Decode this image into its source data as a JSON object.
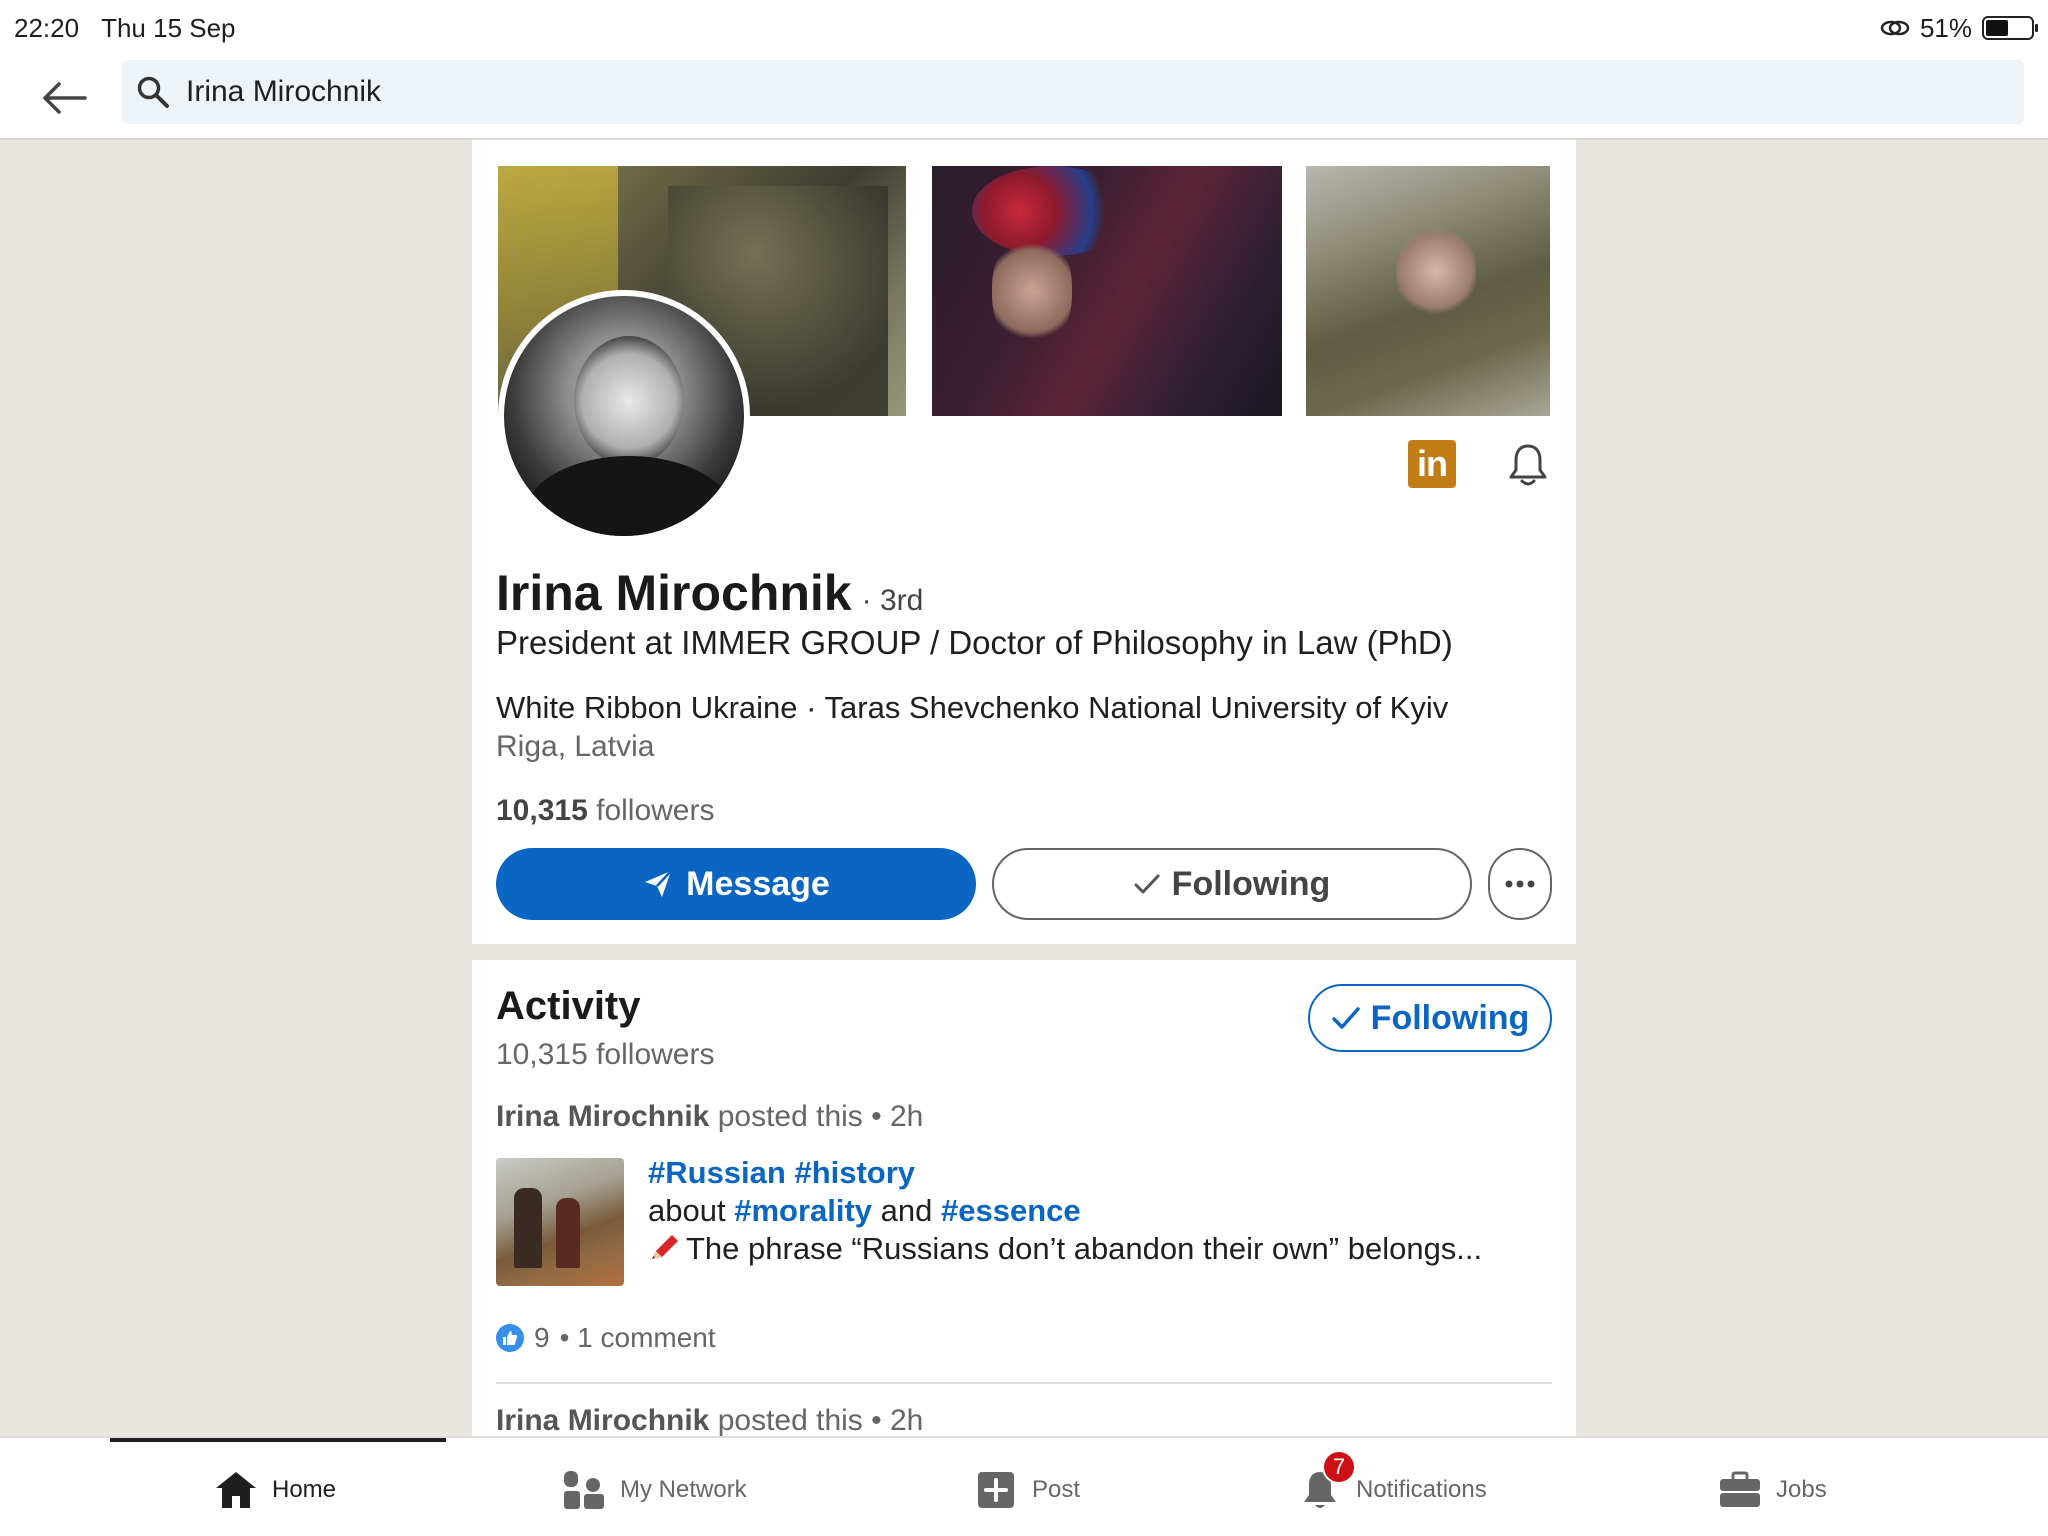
{
  "status_bar": {
    "time": "22:20",
    "date": "Thu 15 Sep",
    "battery": "51%",
    "battery_level": 0.51
  },
  "search": {
    "value": "Irina Mirochnik",
    "placeholder": "Search"
  },
  "profile": {
    "name": "Irina Mirochnik",
    "degree": "· 3rd",
    "headline": "President at IMMER GROUP / Doctor of Philosophy in Law (PhD)",
    "org_line": "White Ribbon Ukraine · Taras Shevchenko National University of Kyiv",
    "location": "Riga, Latvia",
    "followers_count": "10,315",
    "followers_label": "followers",
    "linkedin_badge": "in",
    "message_label": "Message",
    "following_label": "Following"
  },
  "activity": {
    "title": "Activity",
    "followers": "10,315 followers",
    "following_label": "Following",
    "posts": [
      {
        "author": "Irina Mirochnik",
        "meta": "posted this • 2h",
        "tags_line1": "#Russian #history",
        "line2_prefix": "about",
        "tag_morality": "#morality",
        "line2_and": "and",
        "tag_essence": "#essence",
        "line3": "The phrase “Russians don’t abandon their own” belongs...",
        "reaction_count": "9",
        "comments": "• 1 comment"
      },
      {
        "author": "Irina Mirochnik",
        "meta": "posted this • 2h"
      }
    ]
  },
  "nav": {
    "home": "Home",
    "network": "My Network",
    "post": "Post",
    "notifications": "Notifications",
    "notifications_badge": "7",
    "jobs": "Jobs"
  },
  "colors": {
    "brand_blue": "#0a66c2",
    "badge_red": "#cc1016",
    "premium_gold": "#c37d16"
  }
}
